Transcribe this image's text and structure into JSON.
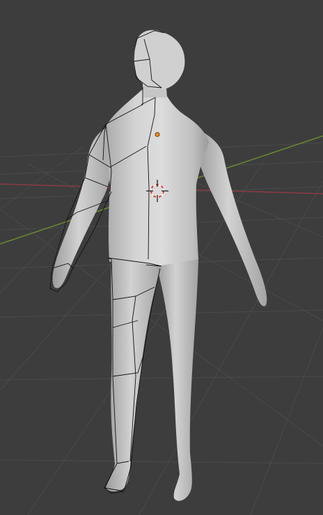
{
  "viewport": {
    "editor": "3D Viewport",
    "shading": "solid",
    "overlays": {
      "floor_grid": true,
      "x_axis": true,
      "y_axis": true,
      "wireframe_cage": true,
      "origin_dot": true,
      "3d_cursor": true
    },
    "object": {
      "type": "humanoid-mesh",
      "modifier": "subdivision-surface"
    }
  },
  "colors": {
    "background": "#3d3d3d",
    "grid_line": "#4a4a4a",
    "x_axis": "#8a3b45",
    "y_axis": "#6b8a32",
    "mesh_light": "#d7d7d7",
    "mesh_shadow": "#9d9d9d",
    "cage_wire": "#121212",
    "origin": "#ff8c1a",
    "cursor_red": "#e04040",
    "cursor_white": "#f2f2f2"
  }
}
